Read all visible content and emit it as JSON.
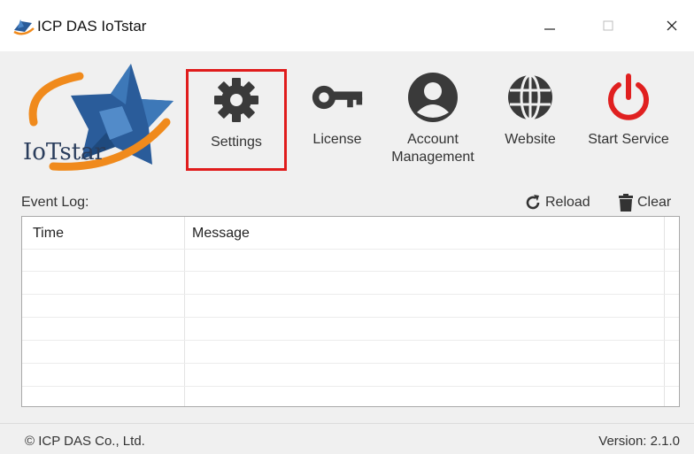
{
  "window": {
    "title": "ICP DAS IoTstar",
    "minimize_icon": "minimize-icon",
    "maximize_icon": "maximize-icon",
    "close_icon": "close-icon"
  },
  "logo": {
    "text": "IoTstar"
  },
  "toolbar": {
    "settings": {
      "label": "Settings",
      "icon": "gear-icon",
      "selected": true
    },
    "license": {
      "label": "License",
      "icon": "key-icon"
    },
    "account": {
      "label_line1": "Account",
      "label_line2": "Management",
      "icon": "user-icon"
    },
    "website": {
      "label": "Website",
      "icon": "globe-icon"
    },
    "start": {
      "label": "Start Service",
      "icon": "power-icon"
    }
  },
  "event_log": {
    "label": "Event Log:",
    "reload_label": "Reload",
    "clear_label": "Clear",
    "columns": [
      "Time",
      "Message"
    ],
    "rows": []
  },
  "footer": {
    "copyright": "© ICP DAS Co., Ltd.",
    "version": "Version: 2.1.0"
  },
  "colors": {
    "selection_border": "#e01c1c",
    "power_red": "#e02020",
    "icon_dark": "#3a3a3a",
    "logo_blue": "#2a5c9a",
    "logo_orange": "#f08a1c"
  }
}
